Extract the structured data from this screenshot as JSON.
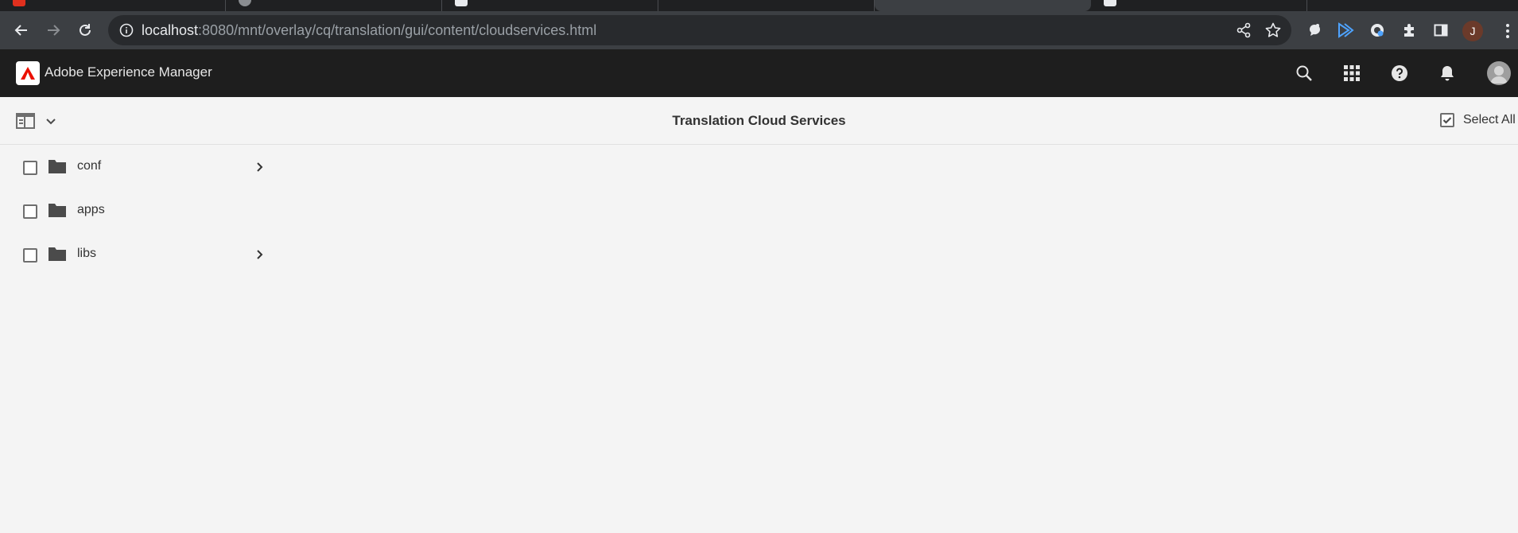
{
  "browser": {
    "tabs": [
      {
        "favicon_color": "#e0301e"
      },
      {
        "favicon_color": "#5f6368"
      },
      {
        "favicon_color": "#e8eaed"
      },
      {
        "favicon_color": "#5f6368"
      },
      {
        "favicon_color": "#e8eaed"
      }
    ],
    "url_host": "localhost",
    "url_rest": ":8080/mnt/overlay/cq/translation/gui/content/cloudservices.html",
    "profile_initial": "J"
  },
  "aem": {
    "product_name": "Adobe Experience Manager",
    "page_title": "Translation Cloud Services",
    "select_all_label": "Select All",
    "items": [
      {
        "name": "conf",
        "has_children": true
      },
      {
        "name": "apps",
        "has_children": false
      },
      {
        "name": "libs",
        "has_children": true
      }
    ]
  },
  "colors": {
    "aem_red": "#eb1000",
    "header_bg": "#1e1e1e",
    "content_bg": "#f4f4f4"
  }
}
